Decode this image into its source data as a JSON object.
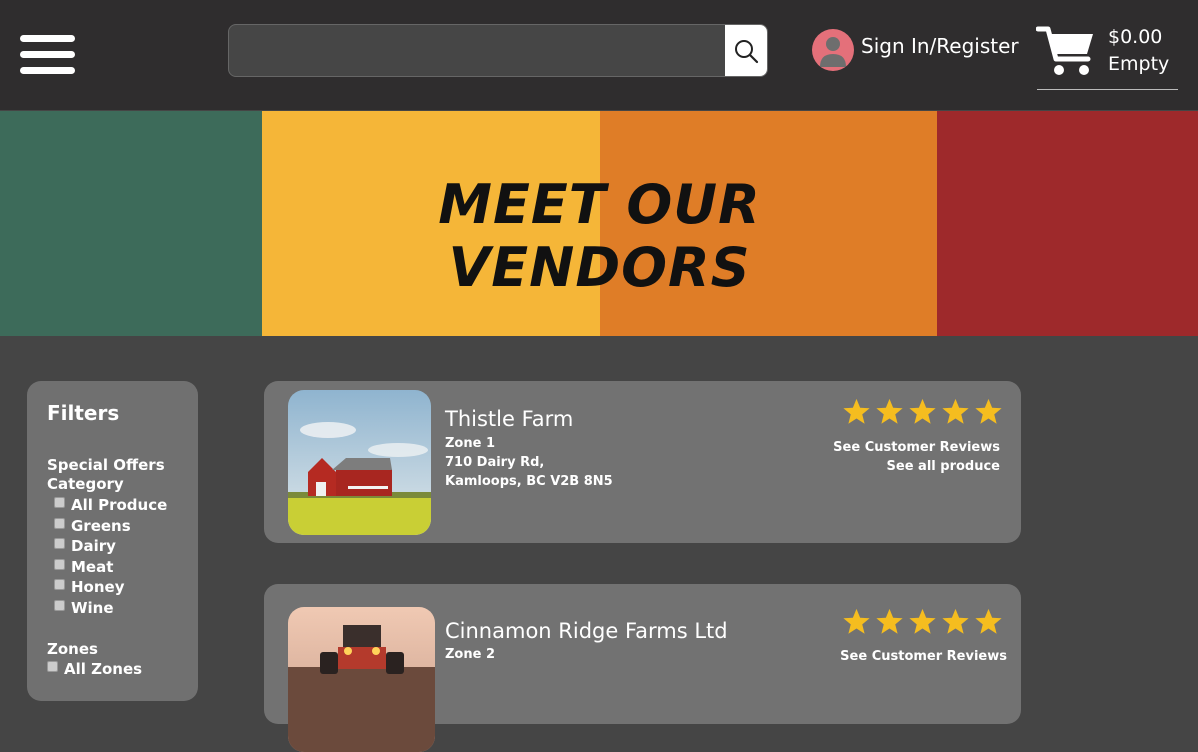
{
  "header": {
    "search": {
      "placeholder": "",
      "value": ""
    },
    "signin_label": "Sign In/Register",
    "cart": {
      "price": "$0.00",
      "status": "Empty"
    }
  },
  "banner": {
    "title_line1": "MEET OUR",
    "title_line2": "VENDORS",
    "colors": [
      "#3d6b5a",
      "#f5b638",
      "#df7d27",
      "#9e292b"
    ]
  },
  "filters": {
    "title": "Filters",
    "special_offers": "Special Offers",
    "category_label": "Category",
    "categories": [
      "All Produce",
      "Greens",
      "Dairy",
      "Meat",
      "Honey",
      "Wine"
    ],
    "zones_label": "Zones",
    "zones": [
      "All Zones"
    ]
  },
  "vendors": [
    {
      "name": "Thistle Farm",
      "zone": "Zone 1",
      "address1": "710 Dairy Rd,",
      "address2": "Kamloops, BC V2B 8N5",
      "rating": 5,
      "reviews_link": "See Customer Reviews",
      "produce_link": "See all produce"
    },
    {
      "name": "Cinnamon Ridge Farms Ltd",
      "zone": "Zone 2",
      "rating": 5,
      "reviews_link": "See Customer Reviews"
    }
  ],
  "colors": {
    "header_bg": "#2f2d2e",
    "page_bg": "#454545",
    "card_bg": "#727272",
    "star": "#f5bd1f"
  }
}
